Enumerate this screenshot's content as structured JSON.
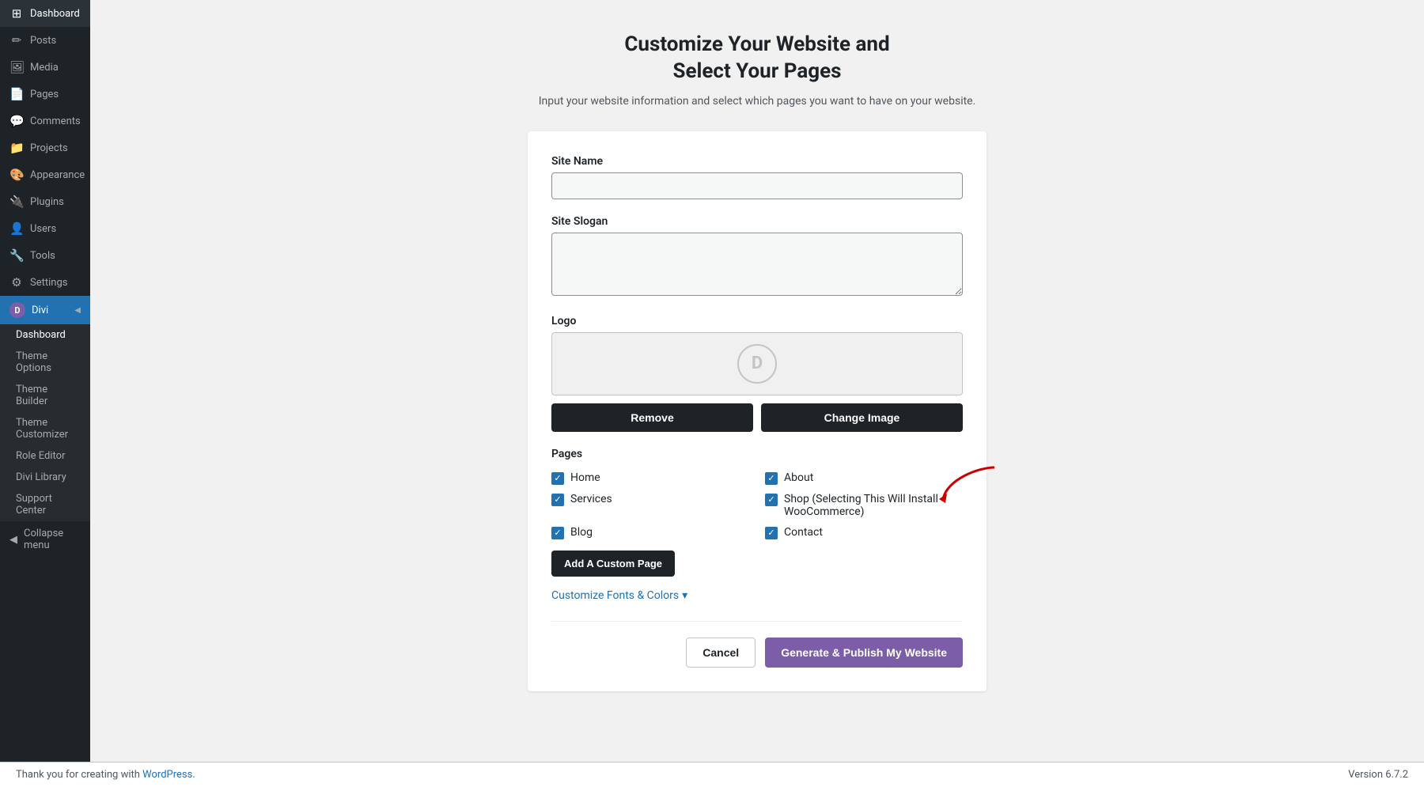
{
  "sidebar": {
    "items": [
      {
        "id": "dashboard",
        "label": "Dashboard",
        "icon": "⊞"
      },
      {
        "id": "posts",
        "label": "Posts",
        "icon": "✏"
      },
      {
        "id": "media",
        "label": "Media",
        "icon": "🖼"
      },
      {
        "id": "pages",
        "label": "Pages",
        "icon": "📄"
      },
      {
        "id": "comments",
        "label": "Comments",
        "icon": "💬"
      },
      {
        "id": "projects",
        "label": "Projects",
        "icon": "📁"
      },
      {
        "id": "appearance",
        "label": "Appearance",
        "icon": "🎨"
      },
      {
        "id": "plugins",
        "label": "Plugins",
        "icon": "🔌"
      },
      {
        "id": "users",
        "label": "Users",
        "icon": "👤"
      },
      {
        "id": "tools",
        "label": "Tools",
        "icon": "🔧"
      },
      {
        "id": "settings",
        "label": "Settings",
        "icon": "⚙"
      }
    ],
    "divi": {
      "label": "Divi",
      "icon": "D",
      "subitems": [
        {
          "id": "dashboard",
          "label": "Dashboard"
        },
        {
          "id": "theme-options",
          "label": "Theme Options"
        },
        {
          "id": "theme-builder",
          "label": "Theme Builder"
        },
        {
          "id": "theme-customizer",
          "label": "Theme Customizer"
        },
        {
          "id": "role-editor",
          "label": "Role Editor"
        },
        {
          "id": "divi-library",
          "label": "Divi Library"
        },
        {
          "id": "support-center",
          "label": "Support Center"
        }
      ]
    },
    "collapse_label": "Collapse menu"
  },
  "main": {
    "title_line1": "Customize Your Website and",
    "title_line2": "Select Your Pages",
    "subtitle": "Input your website information and select which pages you want to have on your website.",
    "form": {
      "site_name_label": "Site Name",
      "site_name_placeholder": "",
      "site_slogan_label": "Site Slogan",
      "site_slogan_placeholder": "",
      "logo_label": "Logo",
      "logo_icon": "D",
      "remove_btn": "Remove",
      "change_image_btn": "Change Image",
      "pages_label": "Pages",
      "pages": [
        {
          "label": "Home",
          "checked": true,
          "col": 1
        },
        {
          "label": "About",
          "checked": true,
          "col": 2
        },
        {
          "label": "Services",
          "checked": true,
          "col": 1
        },
        {
          "label": "Shop (Selecting This Will Install WooCommerce)",
          "checked": true,
          "col": 2
        },
        {
          "label": "Blog",
          "checked": true,
          "col": 1
        },
        {
          "label": "Contact",
          "checked": true,
          "col": 2
        }
      ],
      "add_page_btn": "Add A Custom Page",
      "customize_link": "Customize Fonts & Colors",
      "customize_icon": "▾",
      "cancel_btn": "Cancel",
      "publish_btn": "Generate & Publish My Website"
    }
  },
  "footer": {
    "text": "Thank you for creating with ",
    "link_text": "WordPress.",
    "version": "Version 6.7.2"
  }
}
